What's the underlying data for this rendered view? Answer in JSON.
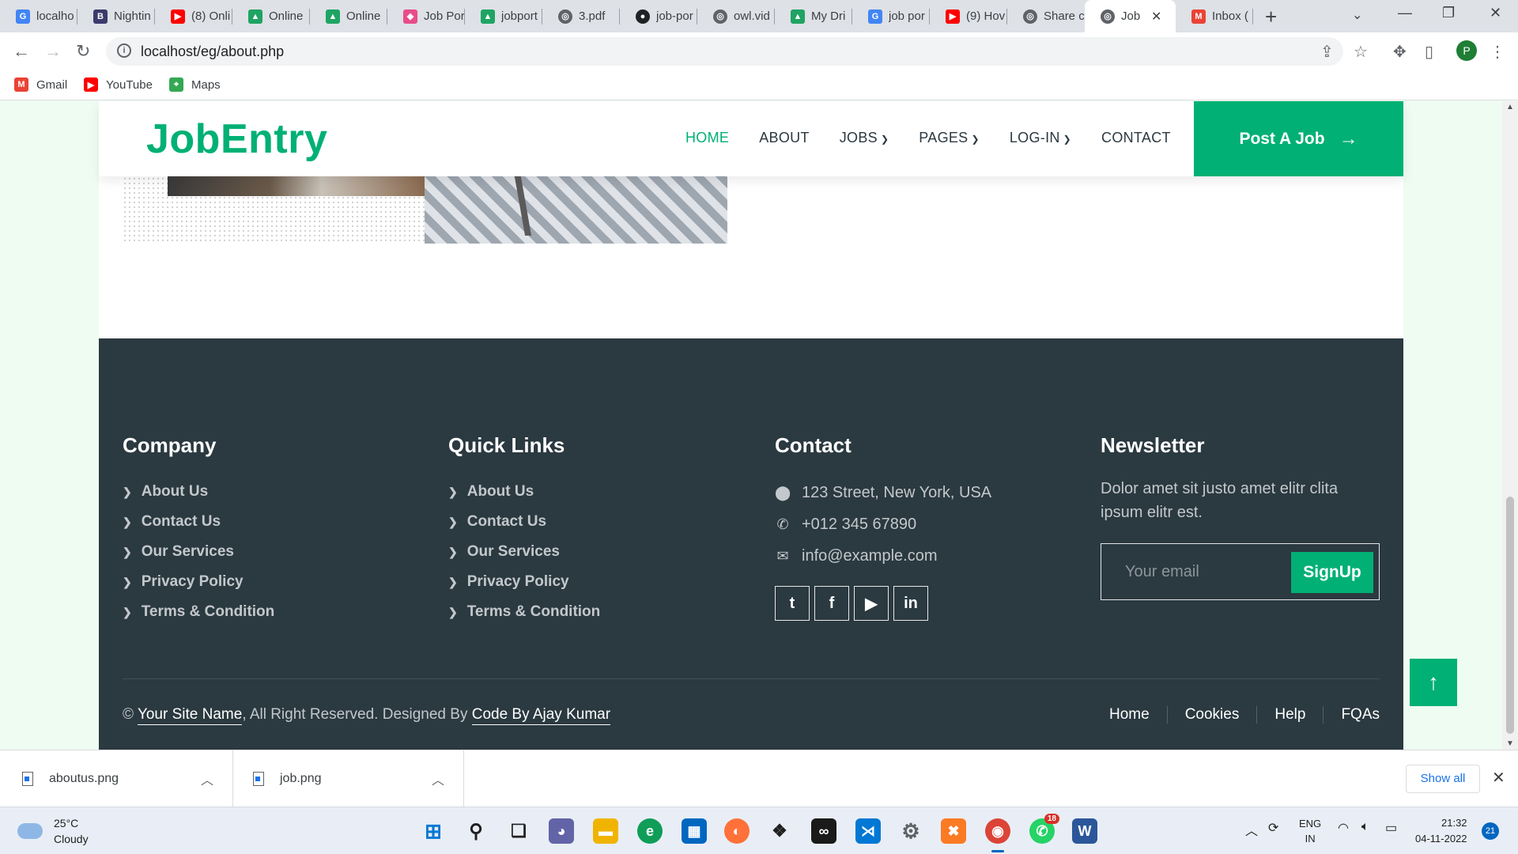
{
  "browser": {
    "tabs": [
      {
        "label": "localho",
        "icon": "google-icon",
        "color": "#4285f4"
      },
      {
        "label": "Nightin",
        "icon": "b-icon",
        "color": "#3b3b6d"
      },
      {
        "label": "(8) Onli",
        "icon": "youtube-icon",
        "color": "#ff0000"
      },
      {
        "label": "Online",
        "icon": "drive-icon",
        "color": "#1fa463"
      },
      {
        "label": "Online",
        "icon": "drive-icon",
        "color": "#1fa463"
      },
      {
        "label": "Job Por",
        "icon": "cube-icon",
        "color": "#e84d8a"
      },
      {
        "label": "jobport",
        "icon": "drive-icon",
        "color": "#1fa463"
      },
      {
        "label": "3.pdf",
        "icon": "globe-icon",
        "color": "#5f6368"
      },
      {
        "label": "job-por",
        "icon": "github-icon",
        "color": "#202124"
      },
      {
        "label": "owl.vid",
        "icon": "globe-icon",
        "color": "#5f6368"
      },
      {
        "label": "My Dri",
        "icon": "drive-icon",
        "color": "#1fa463"
      },
      {
        "label": "job por",
        "icon": "google-icon",
        "color": "#4285f4"
      },
      {
        "label": "(9) Hov",
        "icon": "youtube-icon",
        "color": "#ff0000"
      },
      {
        "label": "Share c",
        "icon": "globe-icon",
        "color": "#5f6368"
      },
      {
        "label": "Job",
        "icon": "globe-icon",
        "color": "#5f6368",
        "active": true
      },
      {
        "label": "Inbox (",
        "icon": "gmail-icon",
        "color": "#ea4335"
      }
    ],
    "url": "localhost/eg/about.php",
    "bookmarks": [
      {
        "label": "Gmail",
        "icon": "gmail-icon",
        "color": "#ea4335"
      },
      {
        "label": "YouTube",
        "icon": "youtube-icon",
        "color": "#ff0000"
      },
      {
        "label": "Maps",
        "icon": "maps-icon",
        "color": "#34a853"
      }
    ],
    "profile_initial": "P"
  },
  "site": {
    "brand": "JobEntry",
    "menu": {
      "home": "HOME",
      "about": "ABOUT",
      "jobs": "JOBS",
      "pages": "PAGES",
      "login": "LOG-IN",
      "contact": "CONTACT"
    },
    "post_job": "Post A Job",
    "accent_color": "#00b074",
    "footer_bg": "#2b3940"
  },
  "footer": {
    "company": {
      "title": "Company",
      "links": [
        "About Us",
        "Contact Us",
        "Our Services",
        "Privacy Policy",
        "Terms & Condition"
      ]
    },
    "quick_links": {
      "title": "Quick Links",
      "links": [
        "About Us",
        "Contact Us",
        "Our Services",
        "Privacy Policy",
        "Terms & Condition"
      ]
    },
    "contact": {
      "title": "Contact",
      "address": "123 Street, New York, USA",
      "phone": "+012 345 67890",
      "email": "info@example.com",
      "social": [
        "twitter-icon",
        "facebook-icon",
        "youtube-icon",
        "linkedin-icon"
      ]
    },
    "newsletter": {
      "title": "Newsletter",
      "text": "Dolor amet sit justo amet elitr clita ipsum elitr est.",
      "placeholder": "Your email",
      "button": "SignUp"
    },
    "copyright": {
      "prefix": "©",
      "site_name": "Your Site Name",
      "middle": ", All Right Reserved. Designed By",
      "designer": "Code By Ajay Kumar"
    },
    "menu": [
      "Home",
      "Cookies",
      "Help",
      "FQAs"
    ]
  },
  "downloads": {
    "items": [
      "aboutus.png",
      "job.png"
    ],
    "show_all": "Show all"
  },
  "taskbar": {
    "weather_temp": "25°C",
    "weather_desc": "Cloudy",
    "lang_top": "ENG",
    "lang_bottom": "IN",
    "time": "21:32",
    "date": "04-11-2022",
    "notifications": "21",
    "whatsapp_badge": "18"
  }
}
